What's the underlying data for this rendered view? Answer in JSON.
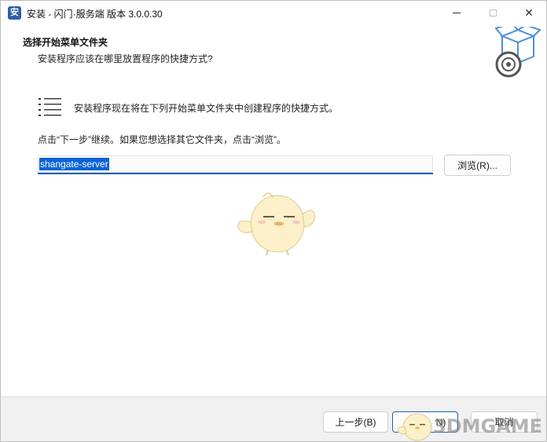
{
  "window": {
    "title": "安装 - 闪门·服务端 版本 3.0.0.30",
    "app_icon_glyph": "安",
    "controls": {
      "minimize": "minimize-icon",
      "maximize": "maximize-icon",
      "close_glyph": "✕"
    }
  },
  "header": {
    "title": "选择开始菜单文件夹",
    "subtitle": "安装程序应该在哪里放置程序的快捷方式?",
    "icon": "software-box-disc-icon"
  },
  "content": {
    "info_icon": "shortcut-list-icon",
    "info_text": "安装程序现在将在下列开始菜单文件夹中创建程序的快捷方式。",
    "hint_text": "点击“下一步”继续。如果您想选择其它文件夹，点击“浏览”。",
    "folder_value": "shangate-server",
    "browse_label": "浏览(R)..."
  },
  "footer": {
    "back_label": "上一步(B)",
    "next_label": "N)",
    "cancel_label": "取消"
  },
  "watermark": {
    "text": "3DMGAME"
  },
  "colors": {
    "accent": "#1b5fb3",
    "selection": "#0a63d6",
    "footer_bg": "#f0f0f0"
  }
}
